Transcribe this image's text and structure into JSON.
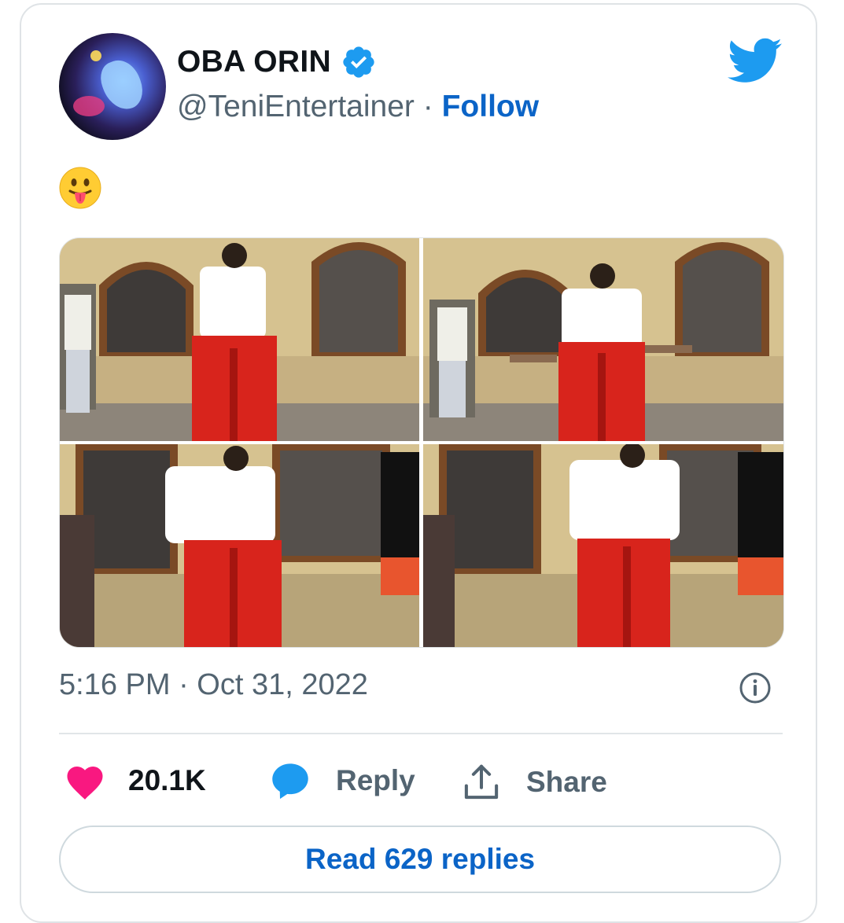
{
  "tweet": {
    "author": {
      "name": "OBA ORIN",
      "handle": "@TeniEntertainer",
      "separator": " · ",
      "follow_label": "Follow",
      "verified": true
    },
    "text_emoji": "😛",
    "media": [
      {
        "description_icon": "photo"
      },
      {
        "description_icon": "photo"
      },
      {
        "description_icon": "photo"
      },
      {
        "description_icon": "photo"
      }
    ],
    "timestamp": "5:16 PM · Oct 31, 2022",
    "actions": {
      "like_count": "20.1K",
      "reply_label": "Reply",
      "share_label": "Share"
    },
    "read_replies_label": "Read 629 replies"
  },
  "colors": {
    "brand_blue": "#1d9bf0",
    "link_blue": "#0b64c7",
    "like_pink": "#f91880",
    "text_primary": "#0f1419",
    "text_secondary": "#536471"
  },
  "icons": {
    "logo": "twitter-bird-icon",
    "verified": "verified-badge-icon",
    "info": "info-icon",
    "like": "heart-icon",
    "reply": "speech-bubble-icon",
    "share": "share-upload-icon"
  }
}
